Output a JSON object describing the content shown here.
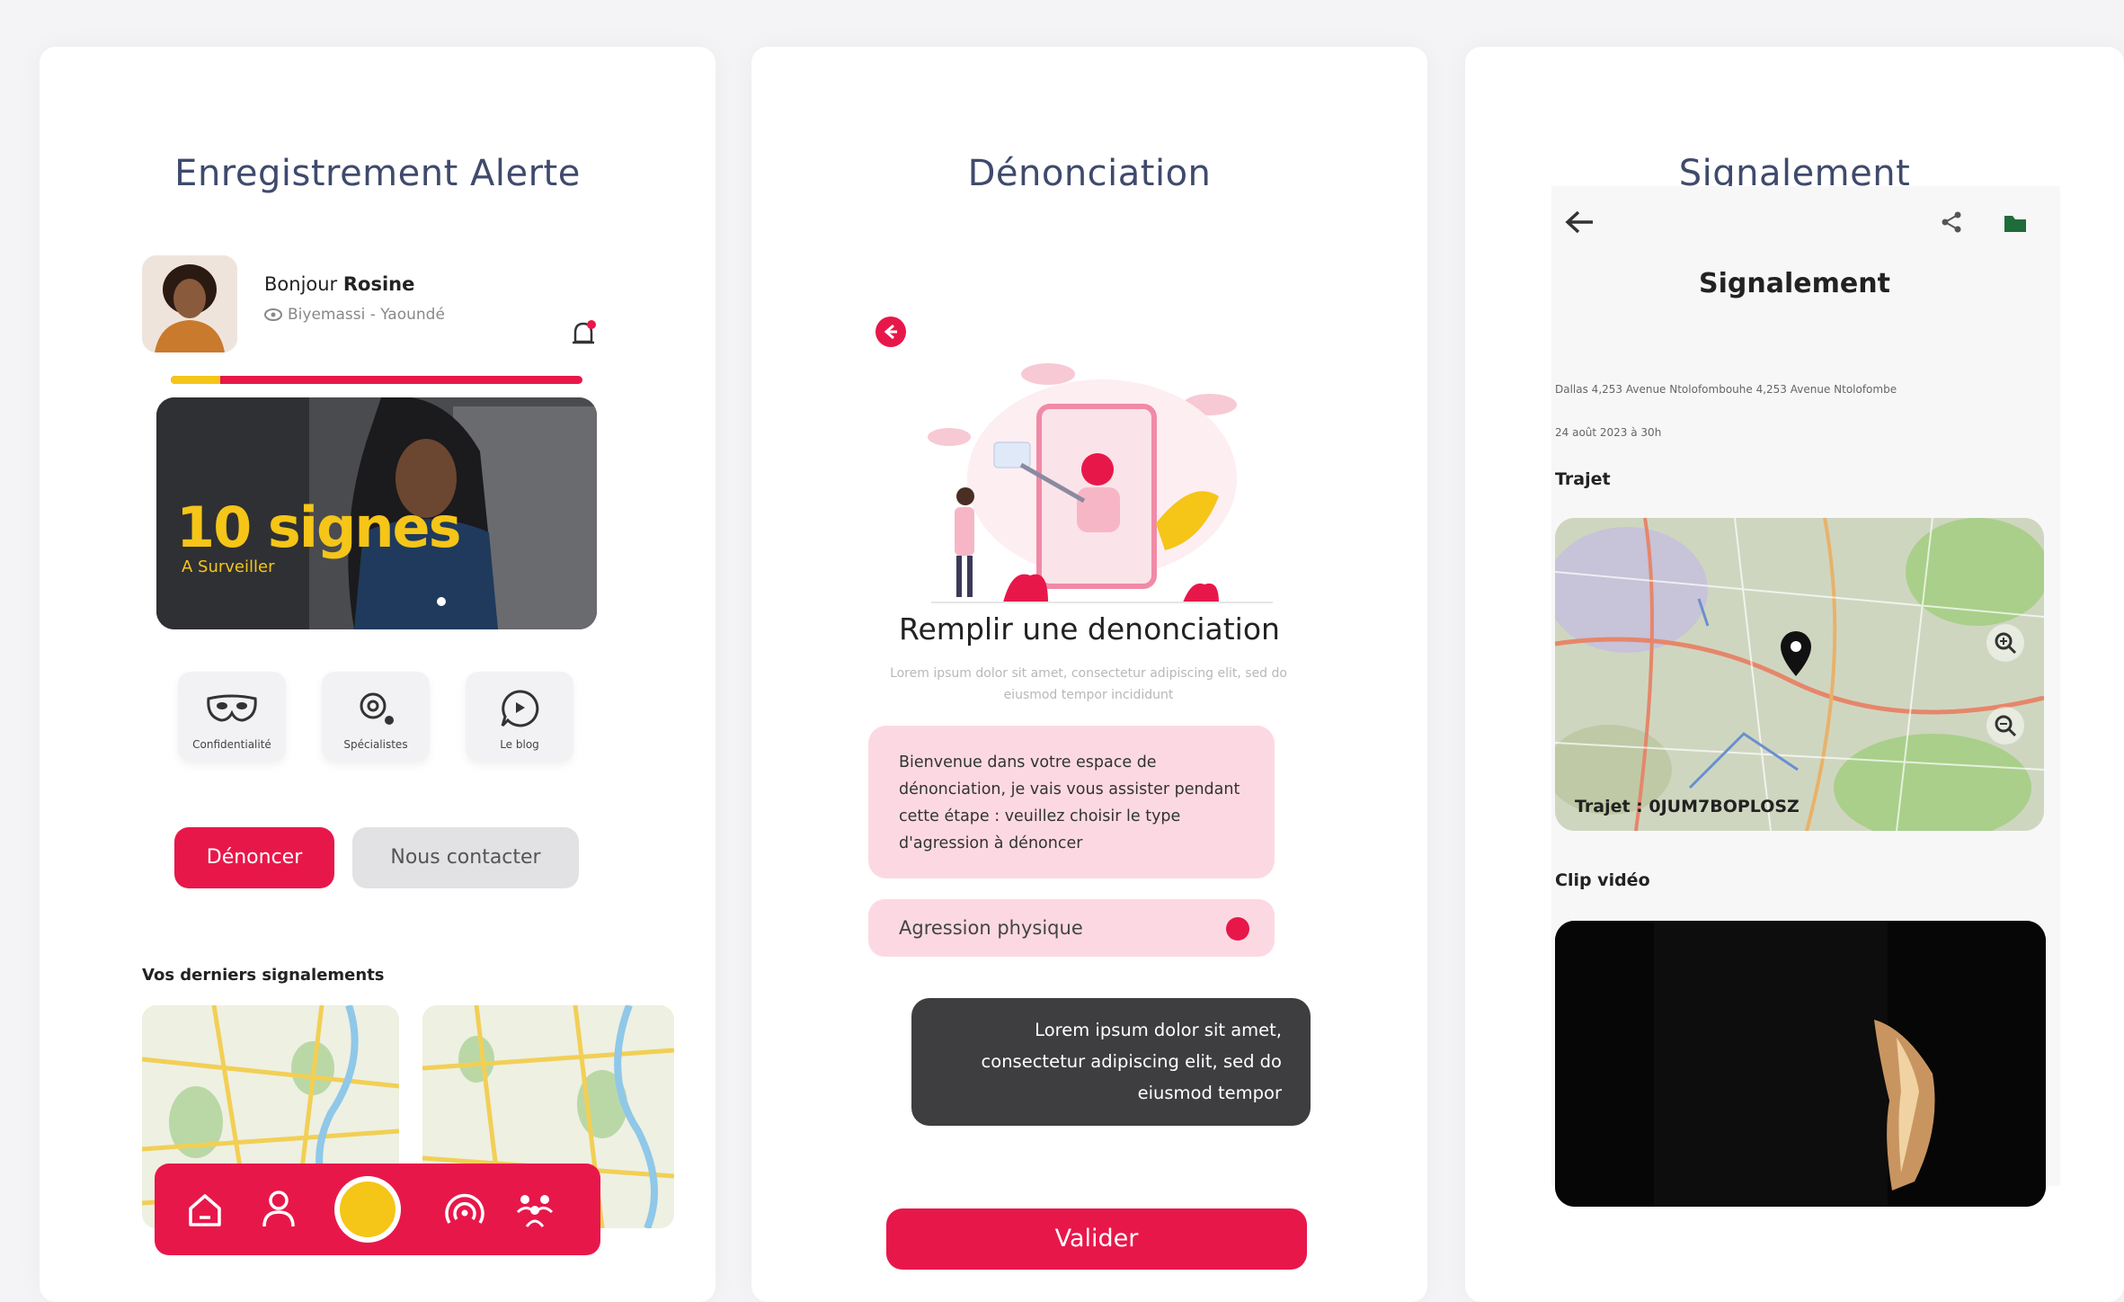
{
  "panels": {
    "p1": {
      "title": "Enregistrement Alerte",
      "greeting_prefix": "Bonjour ",
      "user_name": "Rosine",
      "location": "Biyemassi - Yaoundé",
      "progress_fraction": 0.12,
      "banner": {
        "headline": "10 signes",
        "subline": "A Surveiller"
      },
      "quick_actions": [
        {
          "label": "Confidentialité",
          "icon": "mask-icon"
        },
        {
          "label": "Spécialistes",
          "icon": "gear-person-icon"
        },
        {
          "label": "Le blog",
          "icon": "chat-icon"
        }
      ],
      "report_button": "Dénoncer",
      "contact_button": "Nous contacter",
      "recent_label": "Vos derniers signalements"
    },
    "p2": {
      "title": "Dénonciation",
      "heading": "Remplir une denonciation",
      "subtext": "Lorem ipsum dolor sit amet, consectetur adipiscing elit, sed do eiusmod tempor incididunt",
      "welcome_message": "Bienvenue dans votre espace de dénonciation, je vais vous assister pendant cette étape : veuillez choisir le type d'agression à dénoncer",
      "aggression_type": "Agression physique",
      "reply_bubble": "Lorem ipsum dolor sit amet, consectetur adipiscing elit, sed do eiusmod tempor",
      "submit_button": "Valider"
    },
    "p3": {
      "title": "Signalement",
      "screen_title": "Signalement",
      "address_line": "Dallas 4,253 Avenue Ntolofombouhe 4,253 Avenue Ntolofombe",
      "date_line": "24 août 2023 à 30h",
      "trajet_heading": "Trajet",
      "trajet_id": "Trajet : 0JUM7BOPLOSZ",
      "video_heading": "Clip vidéo"
    }
  },
  "colors": {
    "accent": "#e8174a",
    "yellow": "#f5c518",
    "title": "#3f4a6c",
    "pink_soft": "#fcd9e2",
    "dark_bubble": "#3e3e40"
  }
}
